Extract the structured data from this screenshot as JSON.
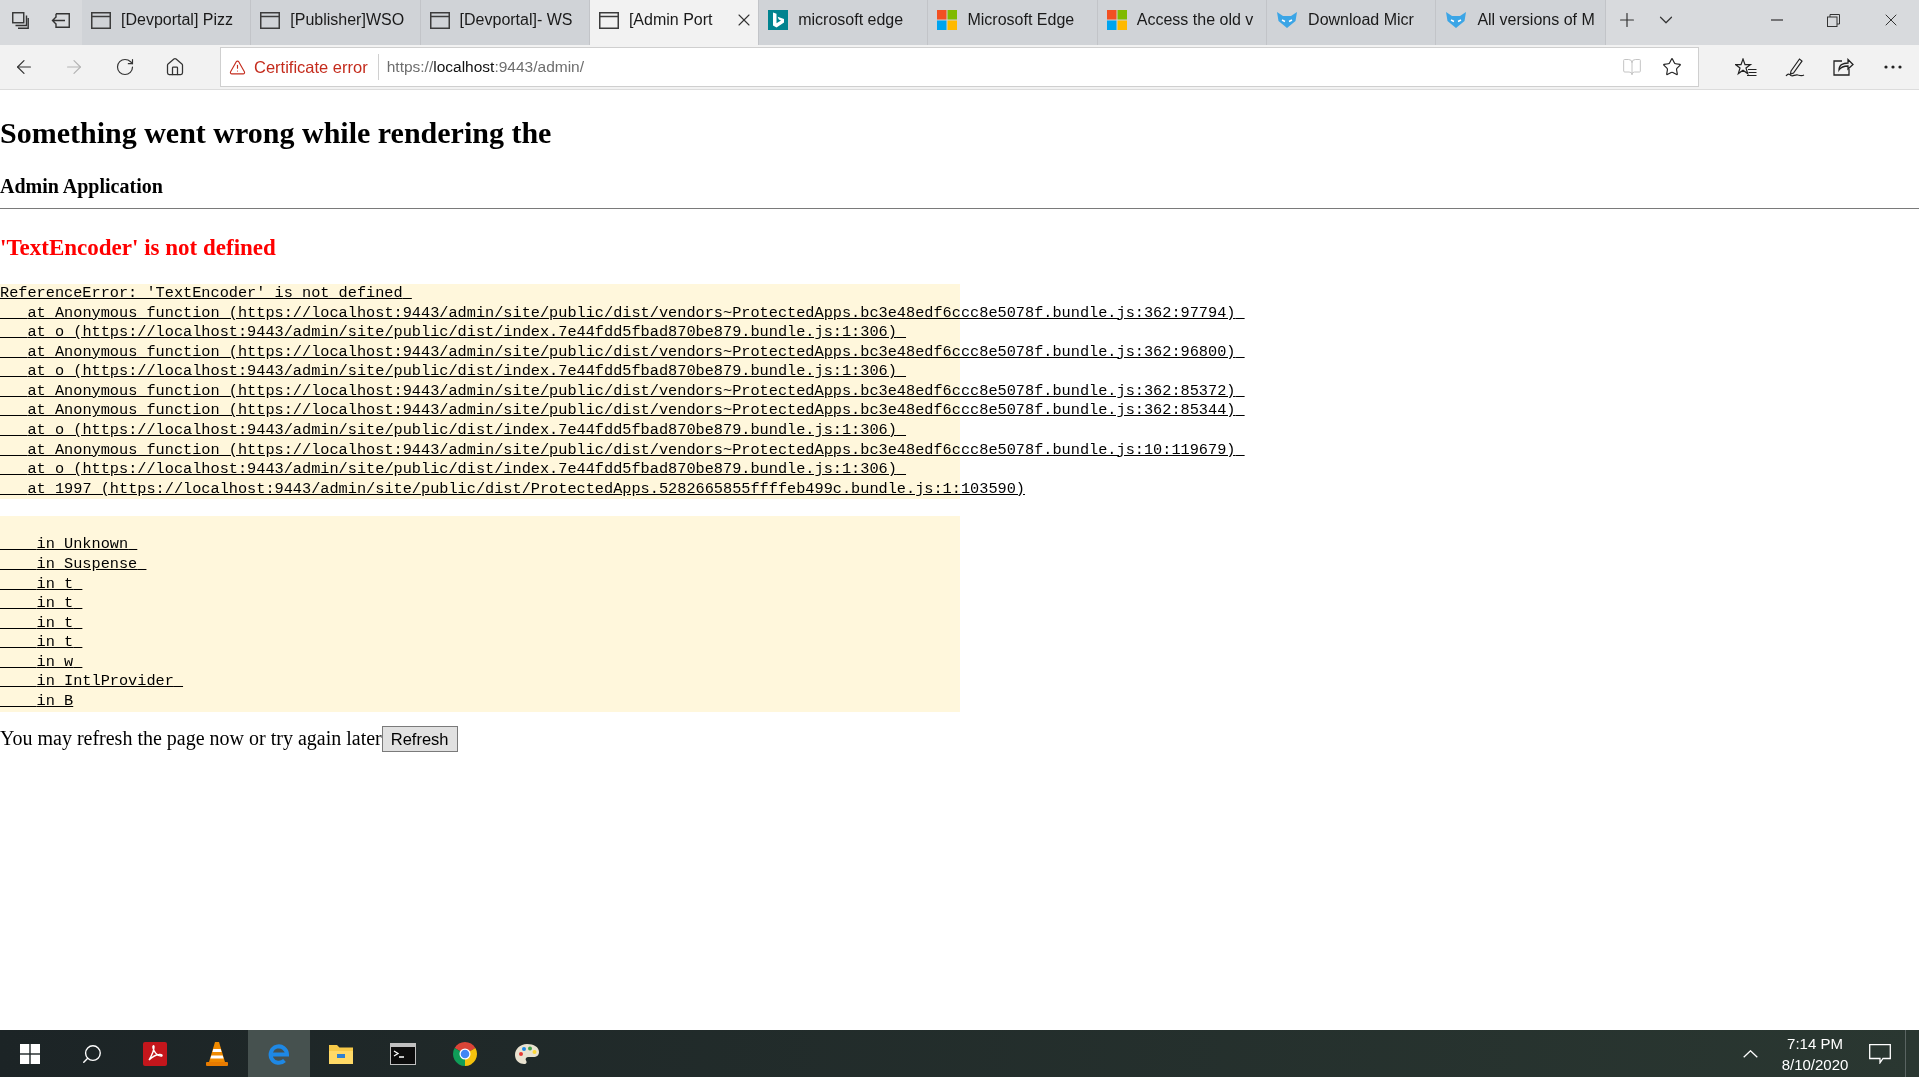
{
  "tabs": [
    {
      "title": "[Devportal] Pizz",
      "kind": "page",
      "selected": false
    },
    {
      "title": "[Publisher]WSO",
      "kind": "page",
      "selected": false
    },
    {
      "title": "[Devportal]- WS",
      "kind": "page",
      "selected": false
    },
    {
      "title": "[Admin Port",
      "kind": "page",
      "selected": true
    },
    {
      "title": "microsoft edge",
      "kind": "letter",
      "selected": false
    },
    {
      "title": "Microsoft Edge",
      "kind": "squares",
      "selected": false
    },
    {
      "title": "Access the old v",
      "kind": "squares",
      "selected": false
    },
    {
      "title": "Download Micr",
      "kind": "animal",
      "selected": false
    },
    {
      "title": "All versions of M",
      "kind": "animal",
      "selected": false
    }
  ],
  "toolbar": {
    "forward_disabled": true,
    "certificate_warning": "Certificate error",
    "address": {
      "scheme": "https://",
      "host": "localhost",
      "rest": ":9443/admin/"
    },
    "reading_view_disabled": true
  },
  "page": {
    "heading": "Something went wrong while rendering the",
    "subheading": "Admin Application",
    "error_title": "'TextEncoder' is not defined",
    "stack_trace": {
      "message": "ReferenceError: 'TextEncoder' is not defined",
      "frames": [
        "at Anonymous function (https://localhost:9443/admin/site/public/dist/vendors~ProtectedApps.bc3e48edf6ccc8e5078f.bundle.js:362:97794)",
        "at o (https://localhost:9443/admin/site/public/dist/index.7e44fdd5fbad870be879.bundle.js:1:306)",
        "at Anonymous function (https://localhost:9443/admin/site/public/dist/vendors~ProtectedApps.bc3e48edf6ccc8e5078f.bundle.js:362:96800)",
        "at o (https://localhost:9443/admin/site/public/dist/index.7e44fdd5fbad870be879.bundle.js:1:306)",
        "at Anonymous function (https://localhost:9443/admin/site/public/dist/vendors~ProtectedApps.bc3e48edf6ccc8e5078f.bundle.js:362:85372)",
        "at Anonymous function (https://localhost:9443/admin/site/public/dist/vendors~ProtectedApps.bc3e48edf6ccc8e5078f.bundle.js:362:85344)",
        "at o (https://localhost:9443/admin/site/public/dist/index.7e44fdd5fbad870be879.bundle.js:1:306)",
        "at Anonymous function (https://localhost:9443/admin/site/public/dist/vendors~ProtectedApps.bc3e48edf6ccc8e5078f.bundle.js:10:119679)",
        "at o (https://localhost:9443/admin/site/public/dist/index.7e44fdd5fbad870be879.bundle.js:1:306)",
        "at 1997 (https://localhost:9443/admin/site/public/dist/ProtectedApps.5282665855ffffeb499c.bundle.js:1:103590)"
      ]
    },
    "component_stack": [
      "in Unknown",
      "in Suspense",
      "in t",
      "in t",
      "in t",
      "in t",
      "in w",
      "in IntlProvider",
      "in B"
    ],
    "message": "You may refresh the page now or try again later",
    "button": "Refresh"
  },
  "taskbar": {
    "apps": [
      {
        "kind": "document",
        "selected": false
      },
      {
        "kind": "cone",
        "selected": false
      },
      {
        "kind": "browser",
        "selected": true
      },
      {
        "kind": "folder",
        "selected": false
      },
      {
        "kind": "terminal",
        "selected": false
      },
      {
        "kind": "wheel",
        "selected": false
      },
      {
        "kind": "palette",
        "selected": false
      }
    ],
    "time": "7:14 PM",
    "date": "8/10/2020"
  }
}
